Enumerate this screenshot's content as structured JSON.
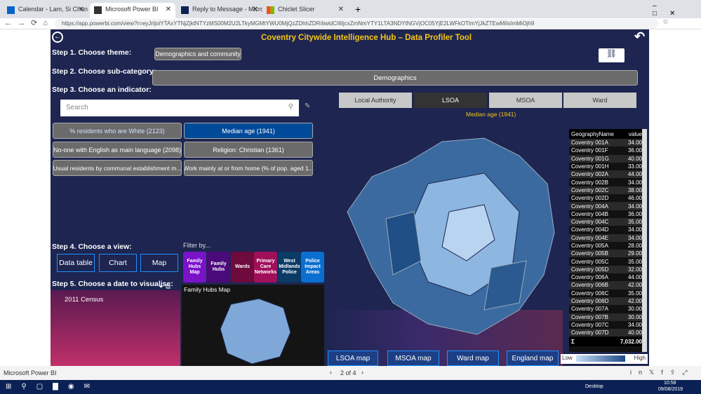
{
  "browser": {
    "tabs": [
      {
        "label": "Calendar - Lam, Si Chun - Outlo"
      },
      {
        "label": "Microsoft Power BI",
        "active": true
      },
      {
        "label": "Reply to Message - Microsoft Po"
      },
      {
        "label": "Chiclet Slicer"
      }
    ],
    "url": "https://app.powerbi.com/view?r=eyJrIjoiYTAxYTNjZjktNTYzMS00M2U2LTkyMGMtYWU0MjQzZDhhZDRiIiwidCI6IjcxZmNmYTY1LTA3NDYtNGVjOC05YjE2LWFkOTlmYjJkZTEwMiIsImMiOjh9"
  },
  "report": {
    "title": "Coventry Citywide Intelligence Hub – Data Profiler Tool",
    "step1": "Step 1. Choose theme:",
    "theme": "Demographics and community",
    "step2": "Step 2. Choose sub-category:",
    "subcategory": "Demographics",
    "step3": "Step 3. Choose an indicator:",
    "search_placeholder": "Search",
    "indicators": [
      "% residents who are White (2123)",
      "Median age (1941)",
      "No-one with English as main language (2098)",
      "Religion: Christian (1361)",
      "Usual residents by communal establishment m...",
      "Work mainly at or from home (% of pop. aged 1..."
    ],
    "selected_indicator": "Median age (1941)",
    "step4": "Step 4. Choose a view:",
    "views": [
      "Data table",
      "Chart",
      "Map"
    ],
    "step5": "Step 5. Choose a date to visualise:",
    "date": "2011 Census",
    "filter_label": "Filter by...",
    "filters": [
      {
        "label": "Family Hubs Map",
        "color": "#7a12c8"
      },
      {
        "label": "Family Hubs",
        "color": "#4a0a7a"
      },
      {
        "label": "Wards",
        "color": "#6e0a3c"
      },
      {
        "label": "Primary Care Networks",
        "color": "#a0105a"
      },
      {
        "label": "West Midlands Police",
        "color": "#0a3a66"
      },
      {
        "label": "Police Impact Areas",
        "color": "#0a6fd0"
      }
    ],
    "mini_map_title": "Family Hubs Map",
    "geo_tabs": [
      "Local Authority",
      "LSOA",
      "MSOA",
      "Ward"
    ],
    "selected_geo": "LSOA",
    "map_title": "Median age (1941)",
    "table": {
      "headers": [
        "GeographyName",
        "value"
      ],
      "rows": [
        [
          "Coventry 001A",
          "34.00"
        ],
        [
          "Coventry 001F",
          "36.00"
        ],
        [
          "Coventry 001G",
          "40.00"
        ],
        [
          "Coventry 001H",
          "33.00"
        ],
        [
          "Coventry 002A",
          "44.00"
        ],
        [
          "Coventry 002B",
          "34.00"
        ],
        [
          "Coventry 002C",
          "38.00"
        ],
        [
          "Coventry 002D",
          "46.00"
        ],
        [
          "Coventry 004A",
          "34.00"
        ],
        [
          "Coventry 004B",
          "36.00"
        ],
        [
          "Coventry 004C",
          "35.00"
        ],
        [
          "Coventry 004D",
          "34.00"
        ],
        [
          "Coventry 004E",
          "34.00"
        ],
        [
          "Coventry 005A",
          "28.00"
        ],
        [
          "Coventry 005B",
          "29.00"
        ],
        [
          "Coventry 005C",
          "35.00"
        ],
        [
          "Coventry 005D",
          "32.00"
        ],
        [
          "Coventry 006A",
          "44.00"
        ],
        [
          "Coventry 006B",
          "42.00"
        ],
        [
          "Coventry 006C",
          "35.00"
        ],
        [
          "Coventry 006D",
          "42.00"
        ],
        [
          "Coventry 007A",
          "30.00"
        ],
        [
          "Coventry 007B",
          "30.00"
        ],
        [
          "Coventry 007C",
          "34.00"
        ],
        [
          "Coventry 007D",
          "40.00"
        ]
      ],
      "total_symbol": "Σ",
      "total": "7,032.00"
    },
    "map_buttons": [
      "LSOA map",
      "MSOA map",
      "Ward map",
      "England map"
    ],
    "legend": {
      "low": "Low",
      "high": "High"
    },
    "colors": {
      "background": "#1d2550",
      "title": "#f5c518",
      "selected": "#004a9a"
    }
  },
  "status": {
    "app": "Microsoft Power BI",
    "page": "2 of 4"
  },
  "taskbar": {
    "desktop": "Desktop",
    "time": "10:58",
    "date": "09/08/2019"
  }
}
